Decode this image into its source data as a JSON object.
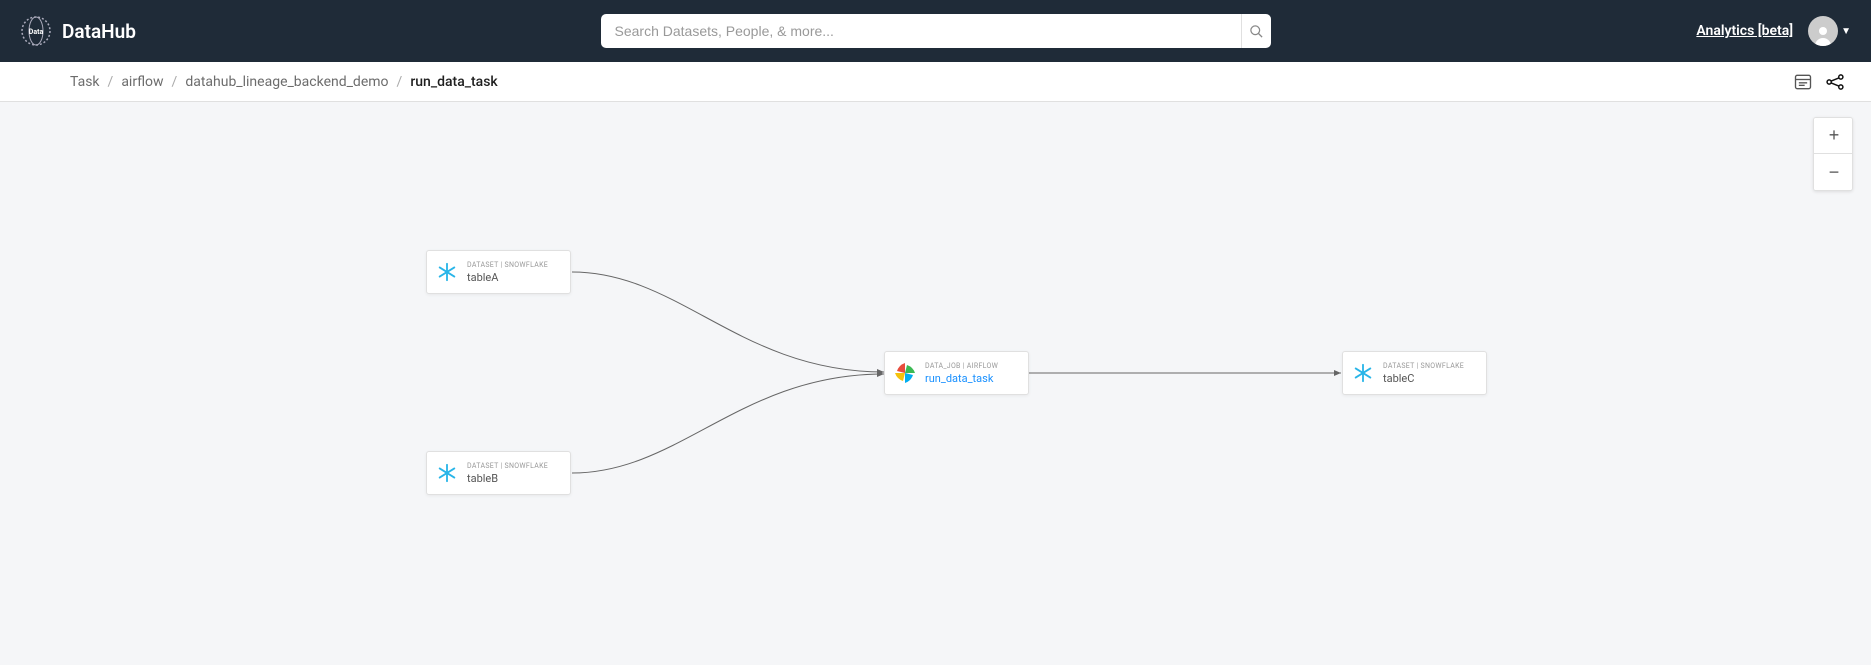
{
  "header": {
    "brand": "DataHub",
    "search_placeholder": "Search Datasets, People, & more...",
    "analytics_label": "Analytics [beta]"
  },
  "breadcrumb": {
    "items": [
      "Task",
      "airflow",
      "datahub_lineage_backend_demo",
      "run_data_task"
    ]
  },
  "zoom": {
    "in": "+",
    "out": "−"
  },
  "nodes": {
    "tableA": {
      "type": "DATASET | SNOWFLAKE",
      "name": "tableA"
    },
    "tableB": {
      "type": "DATASET | SNOWFLAKE",
      "name": "tableB"
    },
    "runTask": {
      "type": "DATA_JOB | AIRFLOW",
      "name": "run_data_task"
    },
    "tableC": {
      "type": "DATASET | SNOWFLAKE",
      "name": "tableC"
    }
  }
}
